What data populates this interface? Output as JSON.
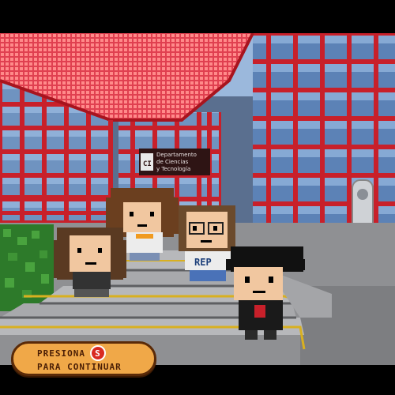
{
  "scene": {
    "sign_lines": [
      "Departamento",
      "de Ciencias",
      "y Tecnología"
    ],
    "shirt_text": "REP",
    "colors": {
      "frame_red": "#c8202a",
      "glass": "#6b93c4",
      "ground": "#9a9a9c",
      "stairs_yellow": "#d8b020"
    }
  },
  "prompt": {
    "line1": "PRESIONA",
    "key": "S",
    "line2": "PARA CONTINUAR"
  }
}
